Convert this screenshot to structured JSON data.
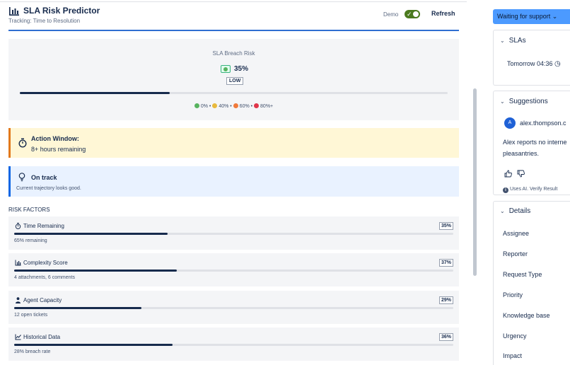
{
  "header": {
    "title": "SLA Risk Predictor",
    "subtitle": "Tracking: Time to Resolution",
    "demo_label": "Demo",
    "demo_enabled": true,
    "refresh_label": "Refresh",
    "icon": "bar-chart-icon"
  },
  "gauge": {
    "title": "SLA Breach Risk",
    "value_text": "35%",
    "value": 35,
    "level": "LOW",
    "legend": [
      {
        "label": "0%",
        "color": "#57b35f"
      },
      {
        "label": "40%",
        "color": "#e8b93d"
      },
      {
        "label": "60%",
        "color": "#f07a3b"
      },
      {
        "label": "80%+",
        "color": "#e0364a"
      }
    ]
  },
  "action_window": {
    "title": "Action Window:",
    "text": "8+ hours remaining",
    "icon": "stopwatch-icon",
    "accent": "#e2791c"
  },
  "status_banner": {
    "title": "On track",
    "text": "Current trajectory looks good.",
    "icon": "lightbulb-icon",
    "accent": "#0c66e4"
  },
  "risk_factors": {
    "heading": "RISK FACTORS",
    "items": [
      {
        "name": "Time Remaining",
        "pct_text": "35%",
        "value": 35,
        "detail": "65% remaining",
        "icon": "stopwatch-icon"
      },
      {
        "name": "Complexity Score",
        "pct_text": "37%",
        "value": 37,
        "detail": "4 attachments, 6 comments",
        "icon": "bar-chart-icon"
      },
      {
        "name": "Agent Capacity",
        "pct_text": "29%",
        "value": 29,
        "detail": "12 open tickets",
        "icon": "person-icon"
      },
      {
        "name": "Historical Data",
        "pct_text": "36%",
        "value": 36,
        "detail": "28% breach rate",
        "icon": "line-chart-icon"
      }
    ]
  },
  "sidebar": {
    "status_label": "Waiting for support",
    "slas": {
      "title": "SLAs",
      "time": "Tomorrow 04:36"
    },
    "suggestions": {
      "title": "Suggestions",
      "avatar_letter": "A",
      "user": "alex.thompson.c",
      "text": "Alex reports no interne pleasantries.",
      "ai_note": "Uses AI. Verify Result"
    },
    "details": {
      "title": "Details",
      "rows": [
        "Assignee",
        "Reporter",
        "Request Type",
        "Priority",
        "Knowledge base",
        "Urgency",
        "Impact"
      ]
    }
  }
}
